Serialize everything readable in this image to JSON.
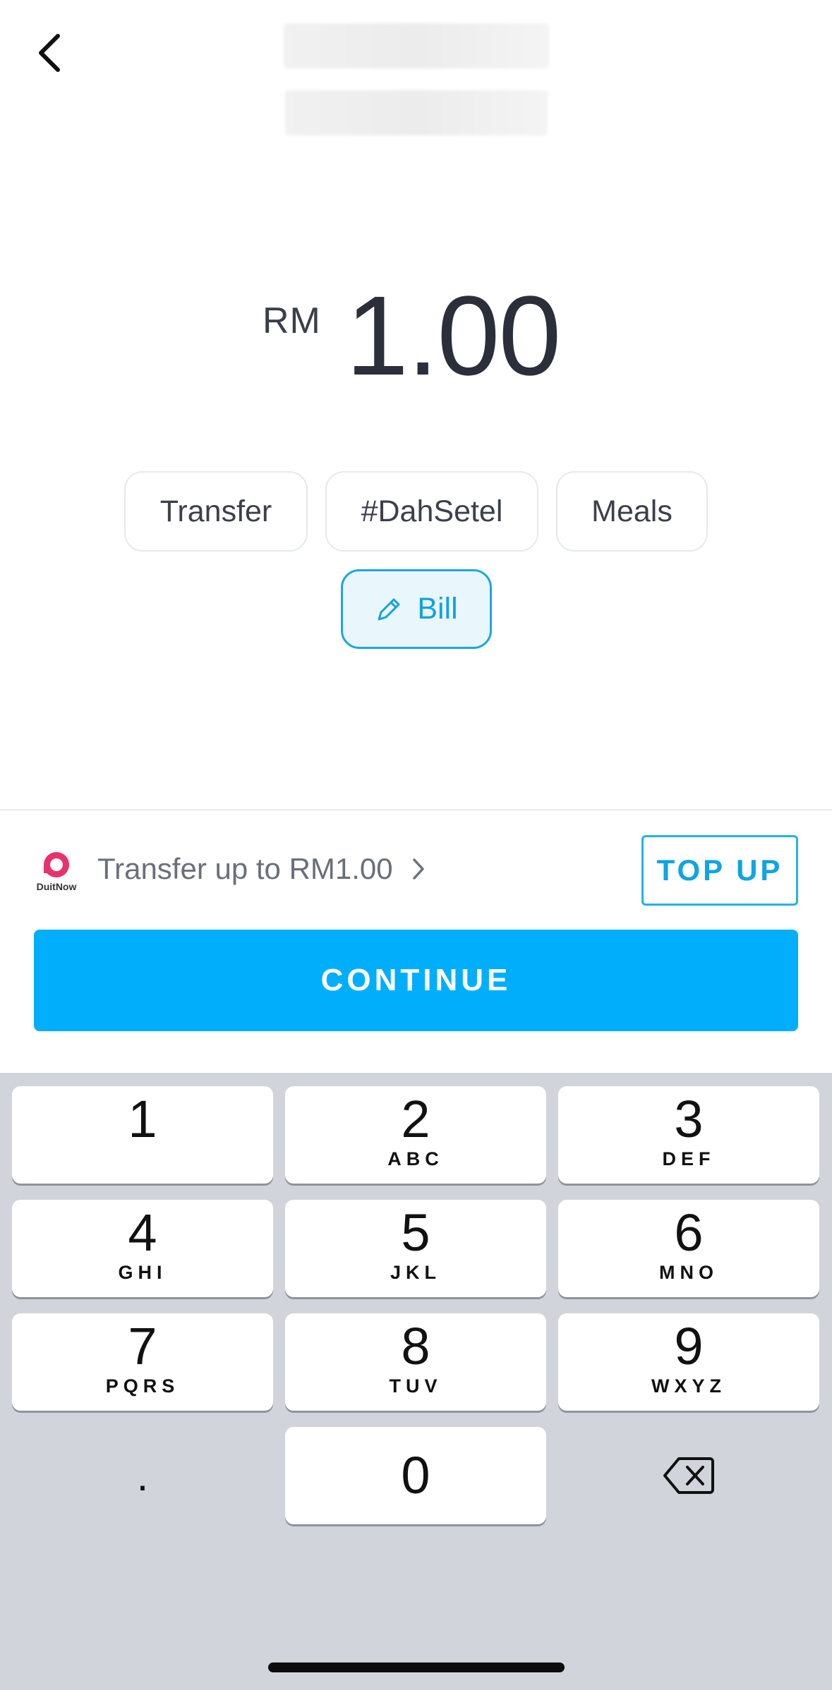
{
  "amount": {
    "currency": "RM",
    "value": "1.00"
  },
  "chips": {
    "transfer": "Transfer",
    "dahsetel": "#DahSetel",
    "meals": "Meals",
    "bill": "Bill"
  },
  "transfer_row": {
    "brand": "DuitNow",
    "text": "Transfer up to RM1.00",
    "topup_label": "TOP UP"
  },
  "continue_label": "CONTINUE",
  "keypad": {
    "keys": [
      {
        "num": "1",
        "letters": ""
      },
      {
        "num": "2",
        "letters": "ABC"
      },
      {
        "num": "3",
        "letters": "DEF"
      },
      {
        "num": "4",
        "letters": "GHI"
      },
      {
        "num": "5",
        "letters": "JKL"
      },
      {
        "num": "6",
        "letters": "MNO"
      },
      {
        "num": "7",
        "letters": "PQRS"
      },
      {
        "num": "8",
        "letters": "TUV"
      },
      {
        "num": "9",
        "letters": "WXYZ"
      },
      {
        "num": "0",
        "letters": ""
      }
    ],
    "dot": "."
  },
  "colors": {
    "accent": "#00aefc",
    "chip_selected_border": "#1aa7e6",
    "duitnow_brand": "#e8326b"
  },
  "icons": {
    "back": "chevron-left-icon",
    "bill": "pencil-icon",
    "chevron": "chevron-right-icon",
    "delete": "backspace-icon",
    "brand": "duitnow-logo"
  }
}
